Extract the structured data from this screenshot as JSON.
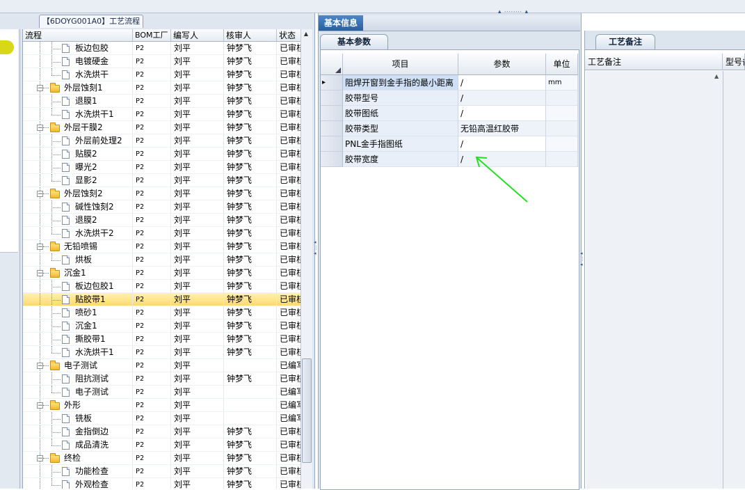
{
  "process_tab": "【6DOYG001A0】工艺流程",
  "left_grid": {
    "columns": [
      "流程",
      "BOM工厂",
      "编写人",
      "核审人",
      "状态"
    ],
    "rows": [
      {
        "depth": 2,
        "type": "doc",
        "name": "板边包胶",
        "bom": "P2",
        "writer": "刘平",
        "reviewer": "钟梦飞",
        "status": "已审核"
      },
      {
        "depth": 2,
        "type": "doc",
        "name": "电镀硬金",
        "bom": "P2",
        "writer": "刘平",
        "reviewer": "钟梦飞",
        "status": "已审核"
      },
      {
        "depth": 2,
        "type": "doc",
        "name": "水洗烘干",
        "bom": "P2",
        "writer": "刘平",
        "reviewer": "钟梦飞",
        "status": "已审核"
      },
      {
        "depth": 1,
        "type": "folder",
        "name": "外层蚀刻1",
        "bom": "P2",
        "writer": "刘平",
        "reviewer": "钟梦飞",
        "status": "已审核"
      },
      {
        "depth": 2,
        "type": "doc",
        "name": "退膜1",
        "bom": "P2",
        "writer": "刘平",
        "reviewer": "钟梦飞",
        "status": "已审核"
      },
      {
        "depth": 2,
        "type": "doc",
        "name": "水洗烘干1",
        "bom": "P2",
        "writer": "刘平",
        "reviewer": "钟梦飞",
        "status": "已审核"
      },
      {
        "depth": 1,
        "type": "folder",
        "name": "外层干膜2",
        "bom": "P2",
        "writer": "刘平",
        "reviewer": "钟梦飞",
        "status": "已审核"
      },
      {
        "depth": 2,
        "type": "doc",
        "name": "外层前处理2",
        "bom": "P2",
        "writer": "刘平",
        "reviewer": "钟梦飞",
        "status": "已审核"
      },
      {
        "depth": 2,
        "type": "doc",
        "name": "贴膜2",
        "bom": "P2",
        "writer": "刘平",
        "reviewer": "钟梦飞",
        "status": "已审核"
      },
      {
        "depth": 2,
        "type": "doc",
        "name": "曝光2",
        "bom": "P2",
        "writer": "刘平",
        "reviewer": "钟梦飞",
        "status": "已审核"
      },
      {
        "depth": 2,
        "type": "doc",
        "name": "显影2",
        "bom": "P2",
        "writer": "刘平",
        "reviewer": "钟梦飞",
        "status": "已审核"
      },
      {
        "depth": 1,
        "type": "folder",
        "name": "外层蚀刻2",
        "bom": "P2",
        "writer": "刘平",
        "reviewer": "钟梦飞",
        "status": "已审核"
      },
      {
        "depth": 2,
        "type": "doc",
        "name": "碱性蚀刻2",
        "bom": "P2",
        "writer": "刘平",
        "reviewer": "钟梦飞",
        "status": "已审核"
      },
      {
        "depth": 2,
        "type": "doc",
        "name": "退膜2",
        "bom": "P2",
        "writer": "刘平",
        "reviewer": "钟梦飞",
        "status": "已审核"
      },
      {
        "depth": 2,
        "type": "doc",
        "name": "水洗烘干2",
        "bom": "P2",
        "writer": "刘平",
        "reviewer": "钟梦飞",
        "status": "已审核"
      },
      {
        "depth": 1,
        "type": "folder",
        "name": "无铅喷锡",
        "bom": "P2",
        "writer": "刘平",
        "reviewer": "钟梦飞",
        "status": "已审核"
      },
      {
        "depth": 2,
        "type": "doc",
        "name": "烘板",
        "bom": "P2",
        "writer": "刘平",
        "reviewer": "钟梦飞",
        "status": "已审核"
      },
      {
        "depth": 1,
        "type": "folder",
        "name": "沉金1",
        "bom": "P2",
        "writer": "刘平",
        "reviewer": "钟梦飞",
        "status": "已审核"
      },
      {
        "depth": 2,
        "type": "doc",
        "name": "板边包胶1",
        "bom": "P2",
        "writer": "刘平",
        "reviewer": "钟梦飞",
        "status": "已审核"
      },
      {
        "depth": 2,
        "type": "doc",
        "name": "贴胶带1",
        "bom": "P2",
        "writer": "刘平",
        "reviewer": "钟梦飞",
        "status": "已审核",
        "selected": true
      },
      {
        "depth": 2,
        "type": "doc",
        "name": "喷砂1",
        "bom": "P2",
        "writer": "刘平",
        "reviewer": "钟梦飞",
        "status": "已审核"
      },
      {
        "depth": 2,
        "type": "doc",
        "name": "沉金1",
        "bom": "P2",
        "writer": "刘平",
        "reviewer": "钟梦飞",
        "status": "已审核"
      },
      {
        "depth": 2,
        "type": "doc",
        "name": "撕胶带1",
        "bom": "P2",
        "writer": "刘平",
        "reviewer": "钟梦飞",
        "status": "已审核"
      },
      {
        "depth": 2,
        "type": "doc",
        "name": "水洗烘干1",
        "bom": "P2",
        "writer": "刘平",
        "reviewer": "钟梦飞",
        "status": "已审核"
      },
      {
        "depth": 1,
        "type": "folder",
        "name": "电子测试",
        "bom": "P2",
        "writer": "刘平",
        "reviewer": "",
        "status": "已编写"
      },
      {
        "depth": 2,
        "type": "doc",
        "name": "阻抗测试",
        "bom": "P2",
        "writer": "刘平",
        "reviewer": "钟梦飞",
        "status": "已审核"
      },
      {
        "depth": 2,
        "type": "doc",
        "name": "电子测试",
        "bom": "P2",
        "writer": "刘平",
        "reviewer": "",
        "status": "已编写"
      },
      {
        "depth": 1,
        "type": "folder",
        "name": "外形",
        "bom": "P2",
        "writer": "刘平",
        "reviewer": "",
        "status": "已编写"
      },
      {
        "depth": 2,
        "type": "doc",
        "name": "铣板",
        "bom": "P2",
        "writer": "刘平",
        "reviewer": "",
        "status": "已编写"
      },
      {
        "depth": 2,
        "type": "doc",
        "name": "金指倒边",
        "bom": "P2",
        "writer": "刘平",
        "reviewer": "钟梦飞",
        "status": "已审核"
      },
      {
        "depth": 2,
        "type": "doc",
        "name": "成品清洗",
        "bom": "P2",
        "writer": "刘平",
        "reviewer": "钟梦飞",
        "status": "已审核"
      },
      {
        "depth": 1,
        "type": "folder",
        "name": "终检",
        "bom": "P2",
        "writer": "刘平",
        "reviewer": "钟梦飞",
        "status": "已审核"
      },
      {
        "depth": 2,
        "type": "doc",
        "name": "功能检查",
        "bom": "P2",
        "writer": "刘平",
        "reviewer": "钟梦飞",
        "status": "已审核"
      },
      {
        "depth": 2,
        "type": "doc",
        "name": "外观检查",
        "bom": "P2",
        "writer": "刘平",
        "reviewer": "钟梦飞",
        "status": "已审核"
      }
    ]
  },
  "middle": {
    "title": "基本信息",
    "tab": "基本参数",
    "columns": [
      "项目",
      "参数",
      "单位"
    ],
    "rows": [
      {
        "item": "阻焊开窗到金手指的最小距离",
        "param": "/",
        "unit": "mm",
        "current": true
      },
      {
        "item": "胶带型号",
        "param": "/",
        "unit": ""
      },
      {
        "item": "胶带图纸",
        "param": "/",
        "unit": ""
      },
      {
        "item": "胶带类型",
        "param": "无铅高温红胶带",
        "unit": ""
      },
      {
        "item": "PNL金手指图纸",
        "param": "/",
        "unit": ""
      },
      {
        "item": "胶带宽度",
        "param": "/",
        "unit": ""
      }
    ],
    "annotation_color": "#22e022"
  },
  "right": {
    "tab": "工艺备注",
    "columns": [
      "工艺备注",
      "型号备注"
    ]
  },
  "colors": {
    "selected_row": "#ffd86a",
    "title_tab": "#2a5f9e",
    "panel_bg": "#dce4ee"
  }
}
